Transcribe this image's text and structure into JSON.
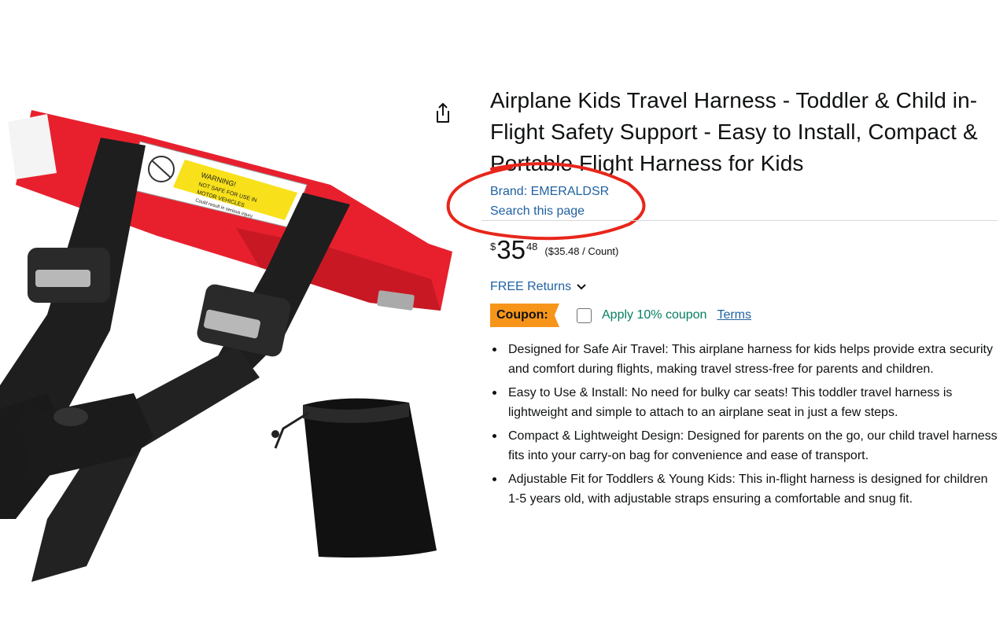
{
  "product": {
    "title": "Airplane Kids Travel Harness - Toddler & Child in-Flight Safety Support - Easy to Install, Compact & Portable Flight Harness for Kids",
    "brand_link": "Brand: EMERALDSR",
    "search_link": "Search this page",
    "image_label_warning": "WARNING!",
    "image_label_line2": "NOT SAFE FOR USE IN",
    "image_label_line3": "MOTOR VEHICLES",
    "image_label_line4": "Could result in serious injury"
  },
  "price": {
    "symbol": "$",
    "whole": "35",
    "fraction": "48",
    "per_unit": "($35.48 / Count)"
  },
  "returns": {
    "label": "FREE Returns"
  },
  "coupon": {
    "badge": "Coupon:",
    "apply_text": "Apply 10% coupon",
    "terms": "Terms",
    "checked": false
  },
  "bullets": [
    "Designed for Safe Air Travel: This airplane harness for kids helps provide extra security and comfort during flights, making travel stress-free for parents and children.",
    "Easy to Use & Install: No need for bulky car seats! This toddler travel harness is lightweight and simple to attach to an airplane seat in just a few steps.",
    "Compact & Lightweight Design: Designed for parents on the go, our child travel harness fits into your carry-on bag for convenience and ease of transport.",
    "Adjustable Fit for Toddlers & Young Kids: This in-flight harness is designed for children 1-5 years old, with adjustable straps ensuring a comfortable and snug fit."
  ],
  "colors": {
    "link": "#2162a1",
    "coupon_badge": "#f7951b",
    "coupon_text": "#067d62",
    "annotation": "#e8261b",
    "strap_red": "#e8202e",
    "strap_black": "#1a1a1a"
  },
  "icons": {
    "share": "share-icon",
    "returns_chevron": "chevron-down-icon"
  }
}
